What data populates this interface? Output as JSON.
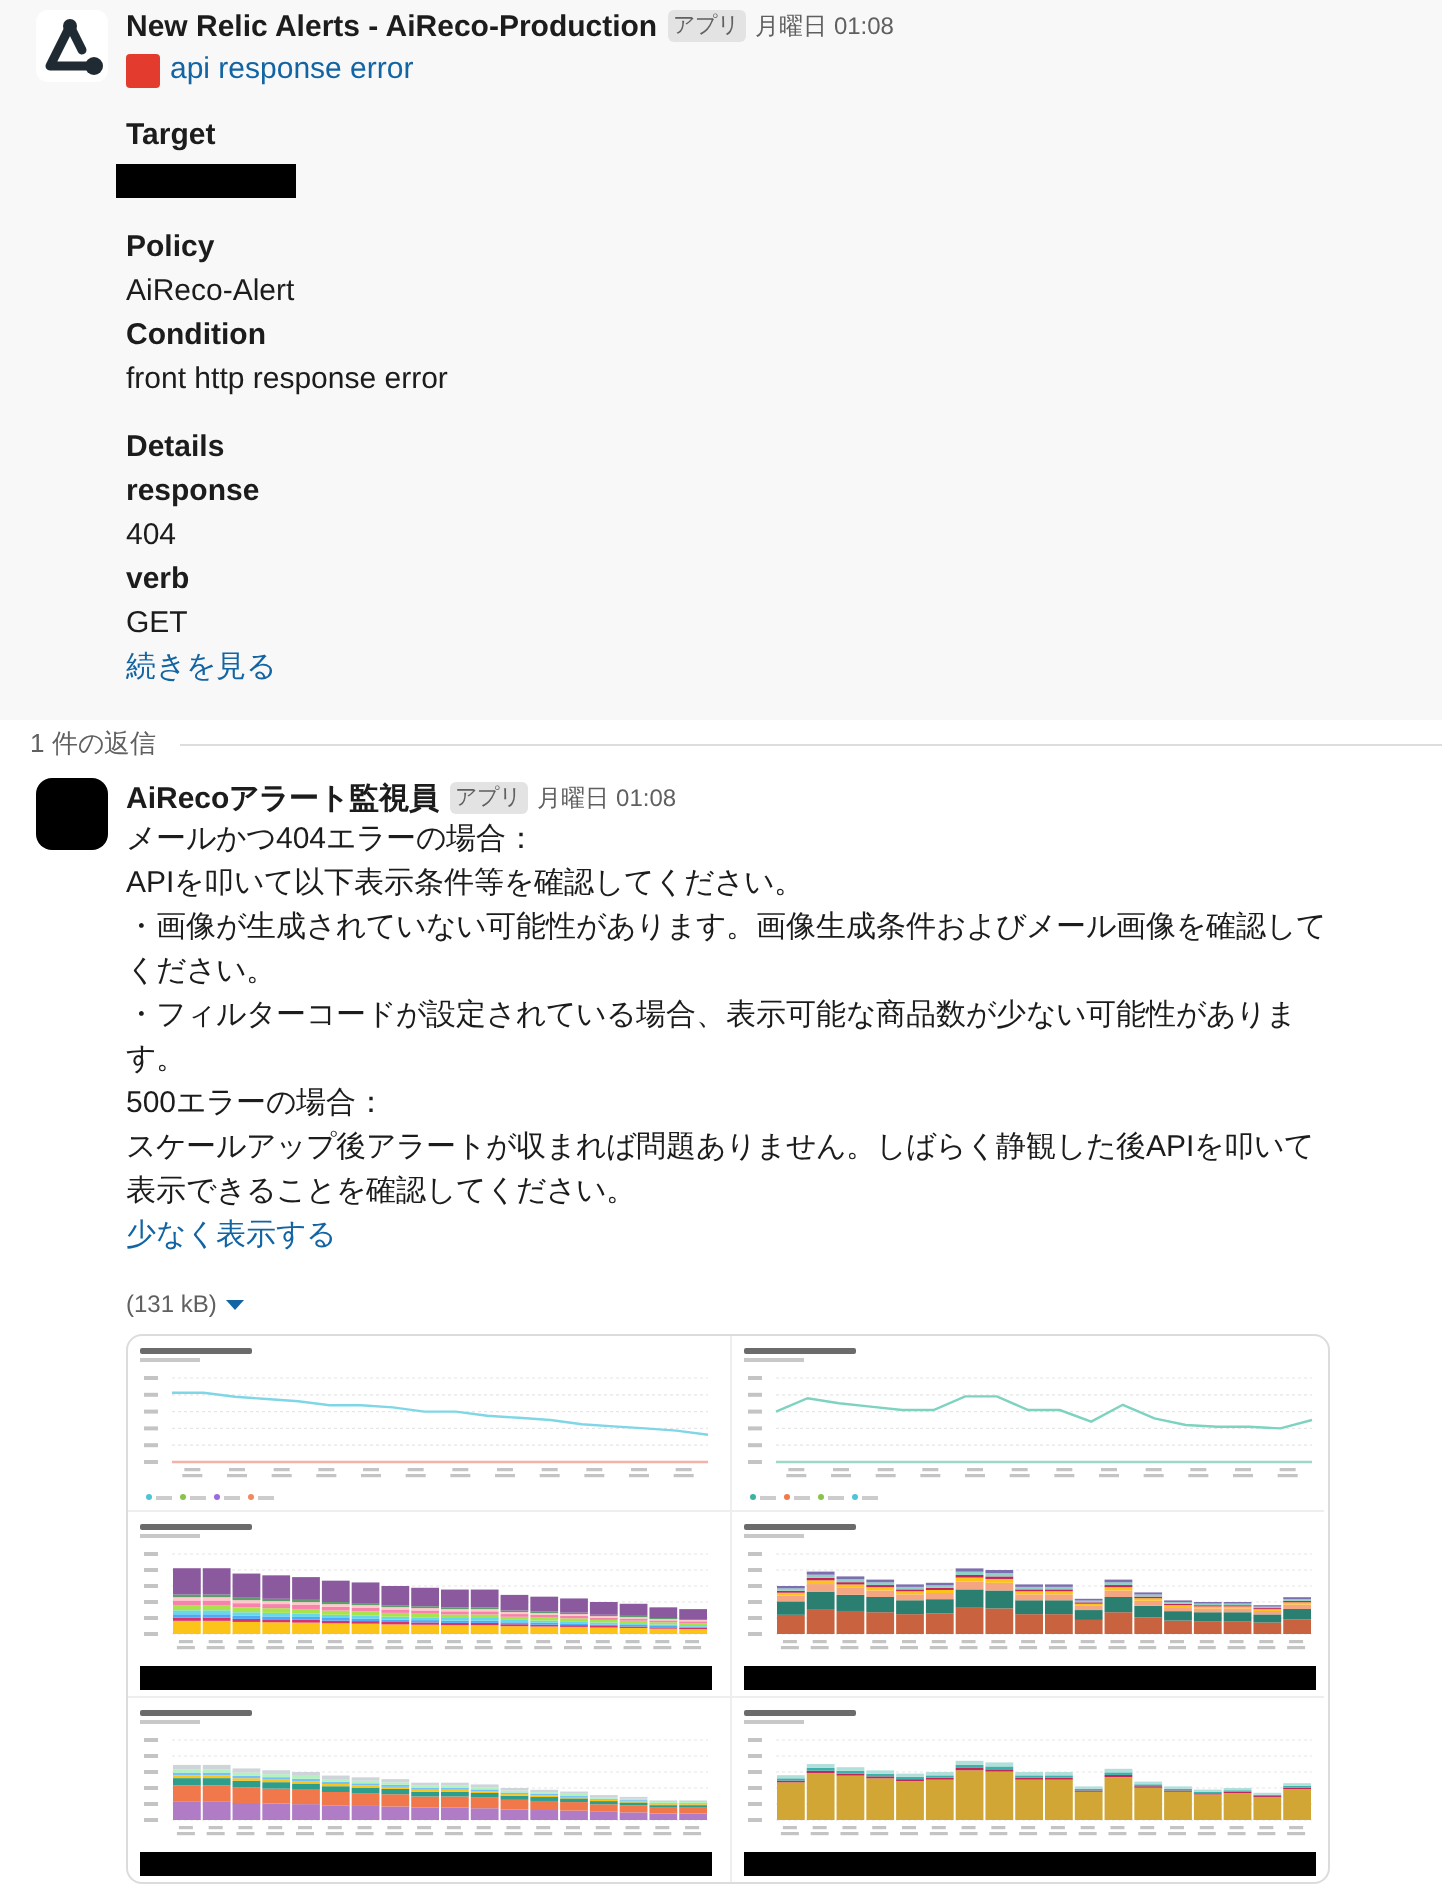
{
  "parent_message": {
    "sender": "New Relic Alerts - AiReco-Production",
    "badge": "アプリ",
    "time": "月曜日 01:08",
    "alert_link": "api response error",
    "sections": [
      {
        "fields": [
          {
            "label": "Target",
            "redacted": true
          }
        ]
      },
      {
        "fields": [
          {
            "label": "Policy",
            "value": "AiReco-Alert",
            "redacted": false
          },
          {
            "label": "Condition",
            "value": "front http response error",
            "redacted": false
          }
        ]
      },
      {
        "heading": "Details",
        "fields": [
          {
            "label": "response",
            "value": "404",
            "redacted": false
          },
          {
            "label": "verb",
            "value": "GET",
            "redacted": false
          }
        ]
      }
    ],
    "show_more_link": "続きを見る"
  },
  "reply_count": "1 件の返信",
  "reply": {
    "sender": "AiRecoアラート監視員",
    "badge": "アプリ",
    "time": "月曜日 01:08",
    "lines": [
      "メールかつ404エラーの場合：",
      "APIを叩いて以下表示条件等を確認してください。",
      "・画像が生成されていない可能性があります。画像生成条件およびメール画像を確認してください。",
      "・フィルターコードが設定されている場合、表示可能な商品数が少ない可能性があります。",
      "500エラーの場合：",
      "スケールアップ後アラートが収まれば問題ありません。しばらく静観した後APIを叩いて表示できることを確認してください。"
    ],
    "show_less_link": "少なく表示する",
    "attachment": {
      "size": "(131 kB)",
      "panels": [
        {
          "kind": "line",
          "redacted": false
        },
        {
          "kind": "line",
          "redacted": false
        },
        {
          "kind": "bar",
          "redacted": true
        },
        {
          "kind": "bar",
          "redacted": true
        },
        {
          "kind": "bar",
          "redacted": true
        },
        {
          "kind": "bar",
          "redacted": true
        }
      ]
    }
  }
}
